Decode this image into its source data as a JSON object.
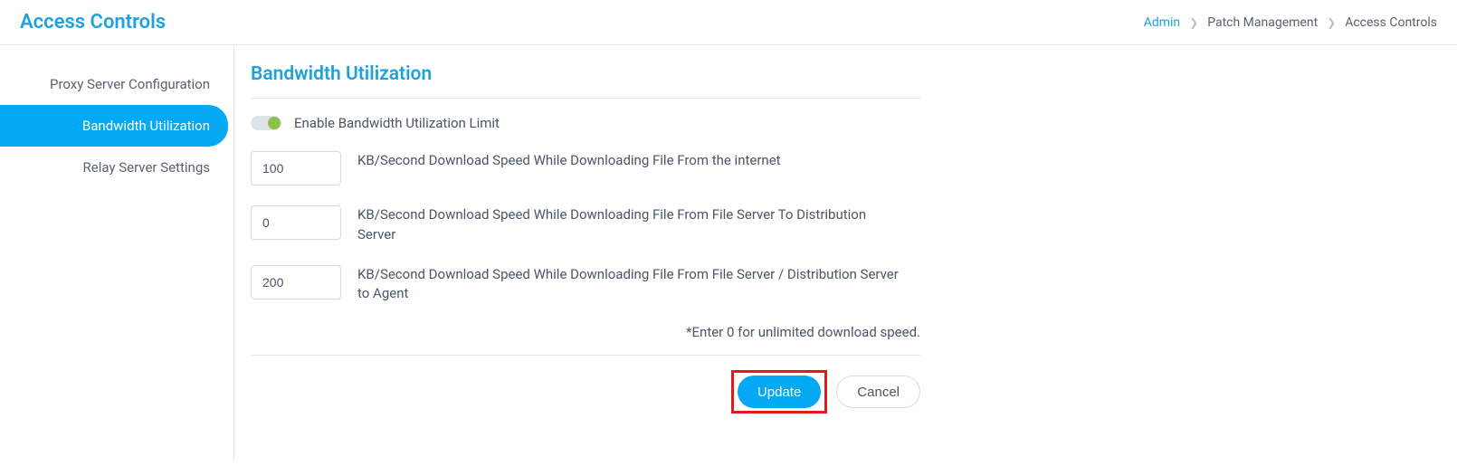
{
  "header": {
    "title": "Access Controls"
  },
  "breadcrumb": {
    "items": [
      "Admin",
      "Patch Management",
      "Access Controls"
    ]
  },
  "sidebar": {
    "items": [
      {
        "label": "Proxy Server Configuration",
        "active": false
      },
      {
        "label": "Bandwidth Utilization",
        "active": true
      },
      {
        "label": "Relay Server Settings",
        "active": false
      }
    ]
  },
  "section": {
    "title": "Bandwidth Utilization",
    "toggle_label": "Enable Bandwidth Utilization Limit",
    "toggle_enabled": true,
    "fields": [
      {
        "value": "100",
        "label": "KB/Second Download Speed While Downloading File From the internet"
      },
      {
        "value": "0",
        "label": "KB/Second Download Speed While Downloading File From File Server To Distribution Server"
      },
      {
        "value": "200",
        "label": "KB/Second Download Speed While Downloading File From File Server / Distribution Server to Agent"
      }
    ],
    "hint": "*Enter 0 for unlimited download speed.",
    "actions": {
      "update": "Update",
      "cancel": "Cancel"
    }
  }
}
